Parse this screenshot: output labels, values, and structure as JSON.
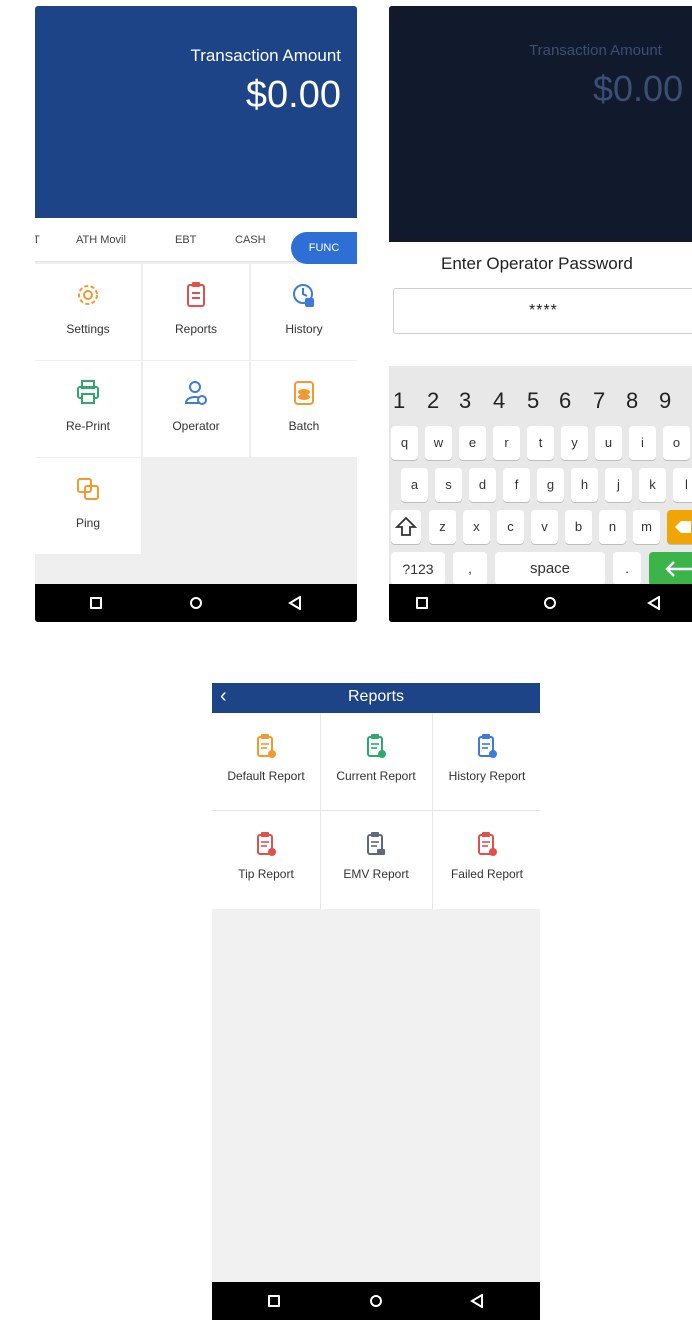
{
  "screen1": {
    "header": {
      "label": "Transaction Amount",
      "amount": "$0.00"
    },
    "tabs": [
      "T",
      "ATH Movil",
      "EBT",
      "CASH",
      "FUNC"
    ],
    "grid": [
      {
        "label": "Settings",
        "icon": "settings-icon",
        "color": "#f39a2e"
      },
      {
        "label": "Reports",
        "icon": "clipboard-icon",
        "color": "#e2504b"
      },
      {
        "label": "History",
        "icon": "history-icon",
        "color": "#3d7bd8"
      },
      {
        "label": "Re-Print",
        "icon": "printer-icon",
        "color": "#2ea86b"
      },
      {
        "label": "Operator",
        "icon": "operator-icon",
        "color": "#3d7bd8"
      },
      {
        "label": "Batch",
        "icon": "batch-icon",
        "color": "#f39a2e"
      },
      {
        "label": "Ping",
        "icon": "ping-icon",
        "color": "#f39a2e"
      }
    ]
  },
  "screen2": {
    "header": {
      "label": "Transaction Amount",
      "amount": "$0.00"
    },
    "dialog": {
      "title": "Enter Operator Password",
      "value": "****"
    },
    "keyboard": {
      "numbers": [
        "1",
        "2",
        "3",
        "4",
        "5",
        "6",
        "7",
        "8",
        "9"
      ],
      "row1": [
        "q",
        "w",
        "e",
        "r",
        "t",
        "y",
        "u",
        "i",
        "o"
      ],
      "row2": [
        "a",
        "s",
        "d",
        "f",
        "g",
        "h",
        "j",
        "k",
        "l"
      ],
      "row3": [
        "z",
        "x",
        "c",
        "v",
        "b",
        "n",
        "m"
      ],
      "bottom": {
        "symbols": "?123",
        "comma": ",",
        "space": "space",
        "period": "."
      }
    }
  },
  "screen3": {
    "title": "Reports",
    "back_icon": "back-chevron-icon",
    "reports": [
      {
        "label": "Default Report",
        "color": "#f39a2e"
      },
      {
        "label": "Current Report",
        "color": "#2ea86b"
      },
      {
        "label": "History Report",
        "color": "#3d7bd8"
      },
      {
        "label": "Tip Report",
        "color": "#e2504b"
      },
      {
        "label": "EMV Report",
        "color": "#5b6b7d"
      },
      {
        "label": "Failed Report",
        "color": "#e2504b"
      }
    ]
  },
  "colors": {
    "brand": "#1d4487",
    "accent": "#2e6fd6",
    "enter": "#3bb54a",
    "backspace": "#f0a500"
  }
}
